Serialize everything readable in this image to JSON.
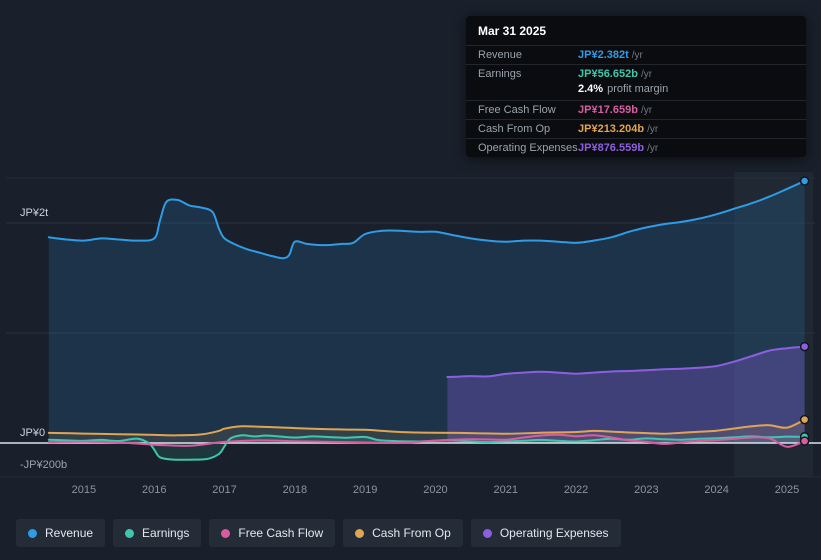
{
  "colors": {
    "revenue": "#2f9ce6",
    "earnings": "#3fc7ad",
    "free_cash_flow": "#d95ca3",
    "cash_from_op": "#dfa553",
    "operating_expenses": "#8d5fe0"
  },
  "tooltip": {
    "date": "Mar 31 2025",
    "rows": [
      {
        "label": "Revenue",
        "value": "JP¥2.382t",
        "suffix": "/yr",
        "color_key": "revenue"
      },
      {
        "label": "Earnings",
        "value": "JP¥56.652b",
        "suffix": "/yr",
        "color_key": "earnings"
      },
      {
        "type": "sub",
        "value": "2.4%",
        "text": "profit margin"
      },
      {
        "label": "Free Cash Flow",
        "value": "JP¥17.659b",
        "suffix": "/yr",
        "color_key": "free_cash_flow"
      },
      {
        "label": "Cash From Op",
        "value": "JP¥213.204b",
        "suffix": "/yr",
        "color_key": "cash_from_op"
      },
      {
        "label": "Operating Expenses",
        "value": "JP¥876.559b",
        "suffix": "/yr",
        "color_key": "operating_expenses"
      }
    ]
  },
  "axis": {
    "y_labels": [
      {
        "text": "JP¥2t",
        "value": 2.0,
        "dy": -16
      },
      {
        "text": "JP¥0",
        "value": 0,
        "dy": -16
      },
      {
        "text": "-JP¥200b",
        "value": -0.2,
        "dy": -6
      }
    ],
    "x_ticks": [
      "2015",
      "2016",
      "2017",
      "2018",
      "2019",
      "2020",
      "2021",
      "2022",
      "2023",
      "2024",
      "2025"
    ]
  },
  "legend": {
    "items": [
      {
        "label": "Revenue",
        "color_key": "revenue"
      },
      {
        "label": "Earnings",
        "color_key": "earnings"
      },
      {
        "label": "Free Cash Flow",
        "color_key": "free_cash_flow"
      },
      {
        "label": "Cash From Op",
        "color_key": "cash_from_op"
      },
      {
        "label": "Operating Expenses",
        "color_key": "operating_expenses"
      }
    ]
  },
  "chart_data": {
    "type": "line",
    "unit": "JP¥ trillions per year",
    "xlim": [
      2013.92,
      2025.37
    ],
    "ylim": [
      -0.309,
      2.464
    ],
    "gridline_values": [
      2.0,
      1.0,
      0
    ],
    "highlight_band": {
      "x_start": 2024.25,
      "x_end": 2025.37
    },
    "series": [
      {
        "name": "Revenue",
        "color_key": "revenue",
        "fill_opacity": 0.16,
        "points": [
          [
            2014.5,
            1.87
          ],
          [
            2014.75,
            1.85
          ],
          [
            2015.0,
            1.84
          ],
          [
            2015.25,
            1.86
          ],
          [
            2015.5,
            1.85
          ],
          [
            2015.75,
            1.84
          ],
          [
            2016.0,
            1.86
          ],
          [
            2016.08,
            2.02
          ],
          [
            2016.17,
            2.19
          ],
          [
            2016.33,
            2.21
          ],
          [
            2016.5,
            2.16
          ],
          [
            2016.67,
            2.14
          ],
          [
            2016.83,
            2.1
          ],
          [
            2016.92,
            1.95
          ],
          [
            2017.0,
            1.86
          ],
          [
            2017.17,
            1.8
          ],
          [
            2017.33,
            1.76
          ],
          [
            2017.5,
            1.73
          ],
          [
            2017.67,
            1.7
          ],
          [
            2017.83,
            1.68
          ],
          [
            2017.92,
            1.71
          ],
          [
            2018.0,
            1.83
          ],
          [
            2018.17,
            1.81
          ],
          [
            2018.33,
            1.8
          ],
          [
            2018.5,
            1.8
          ],
          [
            2018.67,
            1.81
          ],
          [
            2018.83,
            1.82
          ],
          [
            2019.0,
            1.9
          ],
          [
            2019.25,
            1.93
          ],
          [
            2019.5,
            1.93
          ],
          [
            2019.75,
            1.92
          ],
          [
            2020.0,
            1.92
          ],
          [
            2020.25,
            1.89
          ],
          [
            2020.5,
            1.86
          ],
          [
            2020.75,
            1.84
          ],
          [
            2021.0,
            1.83
          ],
          [
            2021.25,
            1.84
          ],
          [
            2021.5,
            1.84
          ],
          [
            2021.75,
            1.83
          ],
          [
            2022.0,
            1.82
          ],
          [
            2022.25,
            1.84
          ],
          [
            2022.5,
            1.87
          ],
          [
            2022.75,
            1.92
          ],
          [
            2023.0,
            1.96
          ],
          [
            2023.25,
            1.99
          ],
          [
            2023.5,
            2.01
          ],
          [
            2023.75,
            2.04
          ],
          [
            2024.0,
            2.08
          ],
          [
            2024.25,
            2.13
          ],
          [
            2024.5,
            2.18
          ],
          [
            2024.75,
            2.24
          ],
          [
            2025.0,
            2.31
          ],
          [
            2025.25,
            2.382
          ]
        ]
      },
      {
        "name": "Operating Expenses",
        "color_key": "operating_expenses",
        "fill_opacity": 0.3,
        "points": [
          [
            2020.17,
            0.6
          ],
          [
            2020.33,
            0.604
          ],
          [
            2020.5,
            0.608
          ],
          [
            2020.75,
            0.606
          ],
          [
            2021.0,
            0.628
          ],
          [
            2021.25,
            0.64
          ],
          [
            2021.5,
            0.648
          ],
          [
            2021.75,
            0.64
          ],
          [
            2022.0,
            0.63
          ],
          [
            2022.25,
            0.64
          ],
          [
            2022.5,
            0.65
          ],
          [
            2022.75,
            0.655
          ],
          [
            2023.0,
            0.662
          ],
          [
            2023.25,
            0.67
          ],
          [
            2023.5,
            0.676
          ],
          [
            2023.75,
            0.684
          ],
          [
            2024.0,
            0.7
          ],
          [
            2024.25,
            0.74
          ],
          [
            2024.5,
            0.79
          ],
          [
            2024.75,
            0.84
          ],
          [
            2025.0,
            0.862
          ],
          [
            2025.25,
            0.8766
          ]
        ]
      },
      {
        "name": "Cash From Op",
        "color_key": "cash_from_op",
        "fill_opacity": 0.12,
        "points": [
          [
            2014.5,
            0.092
          ],
          [
            2015.0,
            0.086
          ],
          [
            2015.5,
            0.08
          ],
          [
            2016.0,
            0.074
          ],
          [
            2016.33,
            0.07
          ],
          [
            2016.67,
            0.078
          ],
          [
            2016.92,
            0.11
          ],
          [
            2017.0,
            0.13
          ],
          [
            2017.25,
            0.152
          ],
          [
            2017.5,
            0.148
          ],
          [
            2017.75,
            0.142
          ],
          [
            2018.0,
            0.136
          ],
          [
            2018.25,
            0.13
          ],
          [
            2018.5,
            0.126
          ],
          [
            2018.75,
            0.122
          ],
          [
            2019.0,
            0.12
          ],
          [
            2019.25,
            0.11
          ],
          [
            2019.5,
            0.1
          ],
          [
            2019.75,
            0.096
          ],
          [
            2020.0,
            0.094
          ],
          [
            2020.5,
            0.09
          ],
          [
            2021.0,
            0.084
          ],
          [
            2021.5,
            0.094
          ],
          [
            2022.0,
            0.1
          ],
          [
            2022.25,
            0.11
          ],
          [
            2022.5,
            0.104
          ],
          [
            2022.75,
            0.096
          ],
          [
            2023.0,
            0.09
          ],
          [
            2023.25,
            0.084
          ],
          [
            2023.5,
            0.094
          ],
          [
            2023.75,
            0.102
          ],
          [
            2024.0,
            0.112
          ],
          [
            2024.25,
            0.132
          ],
          [
            2024.5,
            0.152
          ],
          [
            2024.75,
            0.162
          ],
          [
            2025.0,
            0.14
          ],
          [
            2025.25,
            0.2132
          ]
        ]
      },
      {
        "name": "Earnings",
        "color_key": "earnings",
        "fill_opacity": 0.14,
        "points": [
          [
            2014.5,
            0.03
          ],
          [
            2014.75,
            0.024
          ],
          [
            2015.0,
            0.02
          ],
          [
            2015.25,
            0.028
          ],
          [
            2015.5,
            0.018
          ],
          [
            2015.75,
            0.04
          ],
          [
            2015.92,
            0.0
          ],
          [
            2016.0,
            -0.06
          ],
          [
            2016.08,
            -0.13
          ],
          [
            2016.25,
            -0.15
          ],
          [
            2016.5,
            -0.152
          ],
          [
            2016.75,
            -0.145
          ],
          [
            2016.92,
            -0.1
          ],
          [
            2017.0,
            -0.03
          ],
          [
            2017.08,
            0.04
          ],
          [
            2017.25,
            0.07
          ],
          [
            2017.42,
            0.06
          ],
          [
            2017.58,
            0.068
          ],
          [
            2017.75,
            0.062
          ],
          [
            2018.0,
            0.05
          ],
          [
            2018.25,
            0.06
          ],
          [
            2018.5,
            0.054
          ],
          [
            2018.75,
            0.048
          ],
          [
            2019.0,
            0.055
          ],
          [
            2019.17,
            0.028
          ],
          [
            2019.33,
            0.02
          ],
          [
            2019.5,
            0.016
          ],
          [
            2019.75,
            0.014
          ],
          [
            2020.0,
            0.02
          ],
          [
            2020.25,
            0.026
          ],
          [
            2020.5,
            0.014
          ],
          [
            2020.75,
            0.008
          ],
          [
            2021.0,
            0.014
          ],
          [
            2021.25,
            0.02
          ],
          [
            2021.5,
            0.028
          ],
          [
            2021.75,
            0.02
          ],
          [
            2022.0,
            0.014
          ],
          [
            2022.25,
            0.026
          ],
          [
            2022.5,
            0.038
          ],
          [
            2022.75,
            0.03
          ],
          [
            2023.0,
            0.042
          ],
          [
            2023.25,
            0.034
          ],
          [
            2023.5,
            0.03
          ],
          [
            2023.75,
            0.038
          ],
          [
            2024.0,
            0.044
          ],
          [
            2024.25,
            0.052
          ],
          [
            2024.5,
            0.06
          ],
          [
            2024.75,
            0.052
          ],
          [
            2025.0,
            0.058
          ],
          [
            2025.25,
            0.0567
          ]
        ]
      },
      {
        "name": "Free Cash Flow",
        "color_key": "free_cash_flow",
        "fill_opacity": 0,
        "points": [
          [
            2014.5,
            0.008
          ],
          [
            2015.0,
            0.012
          ],
          [
            2015.5,
            0.005
          ],
          [
            2016.0,
            -0.015
          ],
          [
            2016.5,
            -0.025
          ],
          [
            2017.0,
            0.01
          ],
          [
            2017.5,
            0.024
          ],
          [
            2018.0,
            0.016
          ],
          [
            2018.5,
            0.01
          ],
          [
            2019.0,
            0.005
          ],
          [
            2019.5,
            0.0
          ],
          [
            2020.0,
            0.022
          ],
          [
            2020.5,
            0.034
          ],
          [
            2021.0,
            0.03
          ],
          [
            2021.25,
            0.05
          ],
          [
            2021.5,
            0.068
          ],
          [
            2021.75,
            0.075
          ],
          [
            2022.0,
            0.062
          ],
          [
            2022.25,
            0.07
          ],
          [
            2022.5,
            0.05
          ],
          [
            2022.75,
            0.024
          ],
          [
            2023.0,
            0.01
          ],
          [
            2023.25,
            -0.008
          ],
          [
            2023.5,
            0.006
          ],
          [
            2023.75,
            0.018
          ],
          [
            2024.0,
            0.026
          ],
          [
            2024.25,
            0.038
          ],
          [
            2024.5,
            0.05
          ],
          [
            2024.75,
            0.042
          ],
          [
            2025.0,
            -0.034
          ],
          [
            2025.25,
            0.0177
          ]
        ]
      }
    ]
  }
}
